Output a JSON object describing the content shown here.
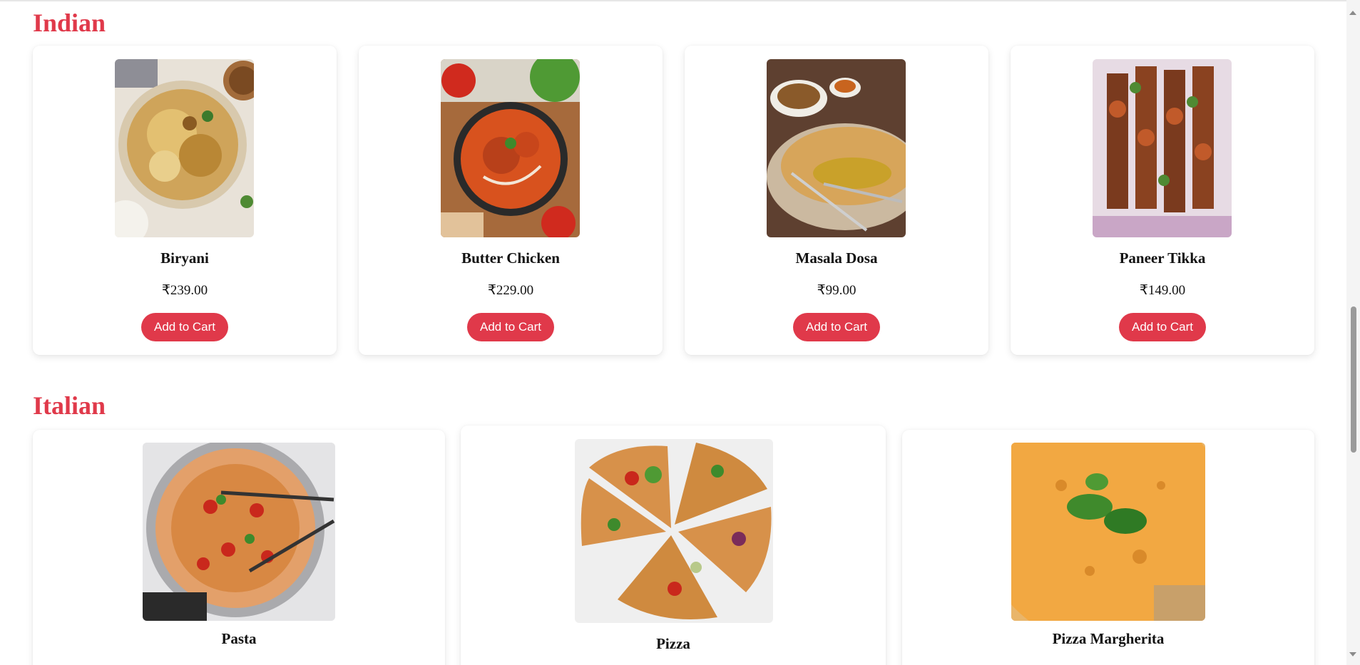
{
  "sections": [
    {
      "title": "Indian",
      "items": [
        {
          "name": "Biryani",
          "price": "₹239.00",
          "button": "Add to Cart",
          "image": "biryani-image"
        },
        {
          "name": "Butter Chicken",
          "price": "₹229.00",
          "button": "Add to Cart",
          "image": "butter-chicken-image"
        },
        {
          "name": "Masala Dosa",
          "price": "₹99.00",
          "button": "Add to Cart",
          "image": "masala-dosa-image"
        },
        {
          "name": "Paneer Tikka",
          "price": "₹149.00",
          "button": "Add to Cart",
          "image": "paneer-tikka-image"
        }
      ]
    },
    {
      "title": "Italian",
      "items": [
        {
          "name": "Pasta",
          "image": "pasta-image"
        },
        {
          "name": "Pizza",
          "image": "pizza-image"
        },
        {
          "name": "Pizza Margherita",
          "image": "pizza-margherita-image"
        }
      ]
    }
  ],
  "colors": {
    "accent": "#e0394a"
  }
}
